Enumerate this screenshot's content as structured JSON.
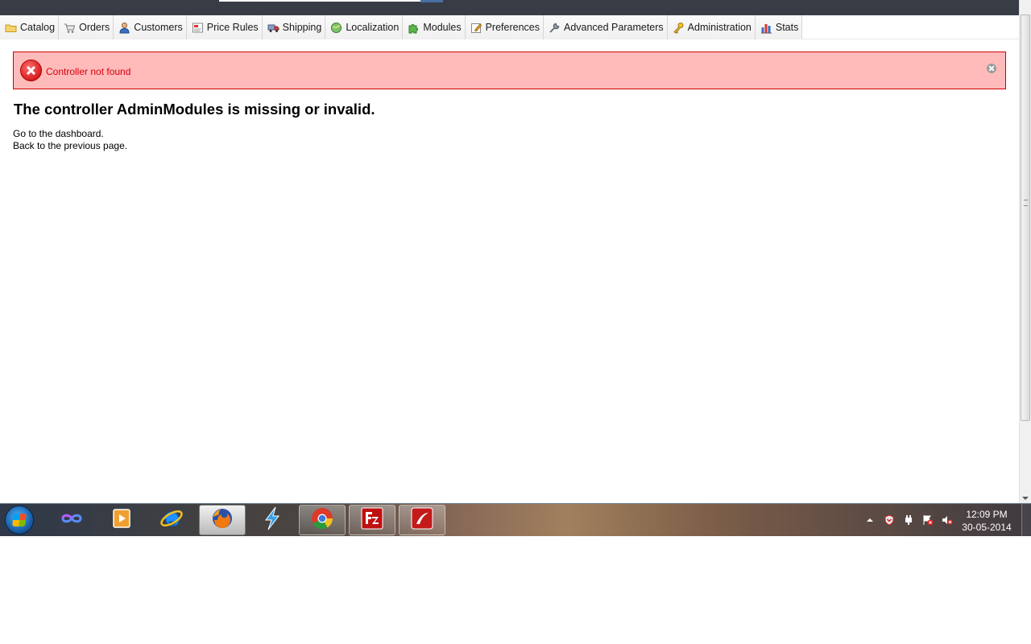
{
  "menu": {
    "tabs": [
      {
        "label": "Catalog",
        "icon": "folder-icon"
      },
      {
        "label": "Orders",
        "icon": "cart-icon"
      },
      {
        "label": "Customers",
        "icon": "user-icon"
      },
      {
        "label": "Price Rules",
        "icon": "price-tag-icon"
      },
      {
        "label": "Shipping",
        "icon": "truck-icon"
      },
      {
        "label": "Localization",
        "icon": "globe-icon"
      },
      {
        "label": "Modules",
        "icon": "puzzle-icon"
      },
      {
        "label": "Preferences",
        "icon": "edit-icon"
      },
      {
        "label": "Advanced Parameters",
        "icon": "wrench-icon"
      },
      {
        "label": "Administration",
        "icon": "key-icon"
      },
      {
        "label": "Stats",
        "icon": "bar-chart-icon"
      }
    ]
  },
  "error": {
    "message": "Controller not found"
  },
  "content": {
    "heading": "The controller AdminModules is missing or invalid.",
    "dashboard_link": "Go to the dashboard.",
    "back_link": "Back to the previous page."
  },
  "taskbar": {
    "apps": [
      "infinity-app-icon",
      "media-player-icon",
      "internet-explorer-icon",
      "firefox-icon",
      "lightning-app-icon",
      "chrome-icon",
      "filezilla-icon",
      "red-app-icon"
    ],
    "clock": {
      "time": "12:09 PM",
      "date": "30-05-2014"
    }
  },
  "colors": {
    "header": "#383d45",
    "error_bg": "#ffbaba",
    "error_text": "#d8000c"
  }
}
